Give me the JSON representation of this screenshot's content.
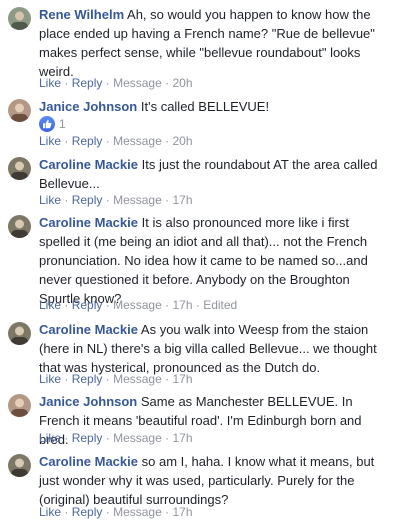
{
  "actions": {
    "like": "Like",
    "reply": "Reply",
    "message": "Message",
    "dot": "·"
  },
  "comments": [
    {
      "author": "Rene Wilhelm",
      "text": "Ah, so would you happen to know how the place ended up having a French name? \"Rue de bellevue\" makes perfect sense, while \"bellevue roundabout\" looks weird.",
      "time": "20h",
      "avatar_color": "#7a8a72"
    },
    {
      "author": "Janice Johnson",
      "text": "It's called BELLEVUE!",
      "time": "20h",
      "reactions": {
        "icon": "thumbs-up-icon",
        "count": "1"
      },
      "avatar_color": "#9a7b6a"
    },
    {
      "author": "Caroline Mackie",
      "text": "Its just the roundabout AT the area called Bellevue...",
      "time": "17h",
      "avatar_color": "#6f6a5c"
    },
    {
      "author": "Caroline Mackie",
      "text": "It is also pronounced more like i first spelled it (me being an idiot and all that)... not the French pronunciation. No idea how it came to be named so...and never questioned it before. Anybody on the Broughton Spurtle know?",
      "time": "17h",
      "edited": "Edited",
      "avatar_color": "#6f6a5c"
    },
    {
      "author": "Caroline Mackie",
      "text": "As you walk into Weesp from the staion (here in NL) there's a big villa called Bellevue... we thought that was hysterical, pronounced as the Dutch do.",
      "time": "17h",
      "avatar_color": "#6f6a5c"
    },
    {
      "author": "Janice Johnson",
      "text": "Same as Manchester BELLEVUE. In French it means 'beautiful road'. I'm Edinburgh born and bred.",
      "time": "17h",
      "avatar_color": "#9a7b6a"
    },
    {
      "author": "Caroline Mackie",
      "text": "so am I, haha. I know what it means, but just wonder why it was used, particularly. Purely for the (original) beautiful surroundings?",
      "time": "17h",
      "avatar_color": "#6f6a5c"
    }
  ]
}
